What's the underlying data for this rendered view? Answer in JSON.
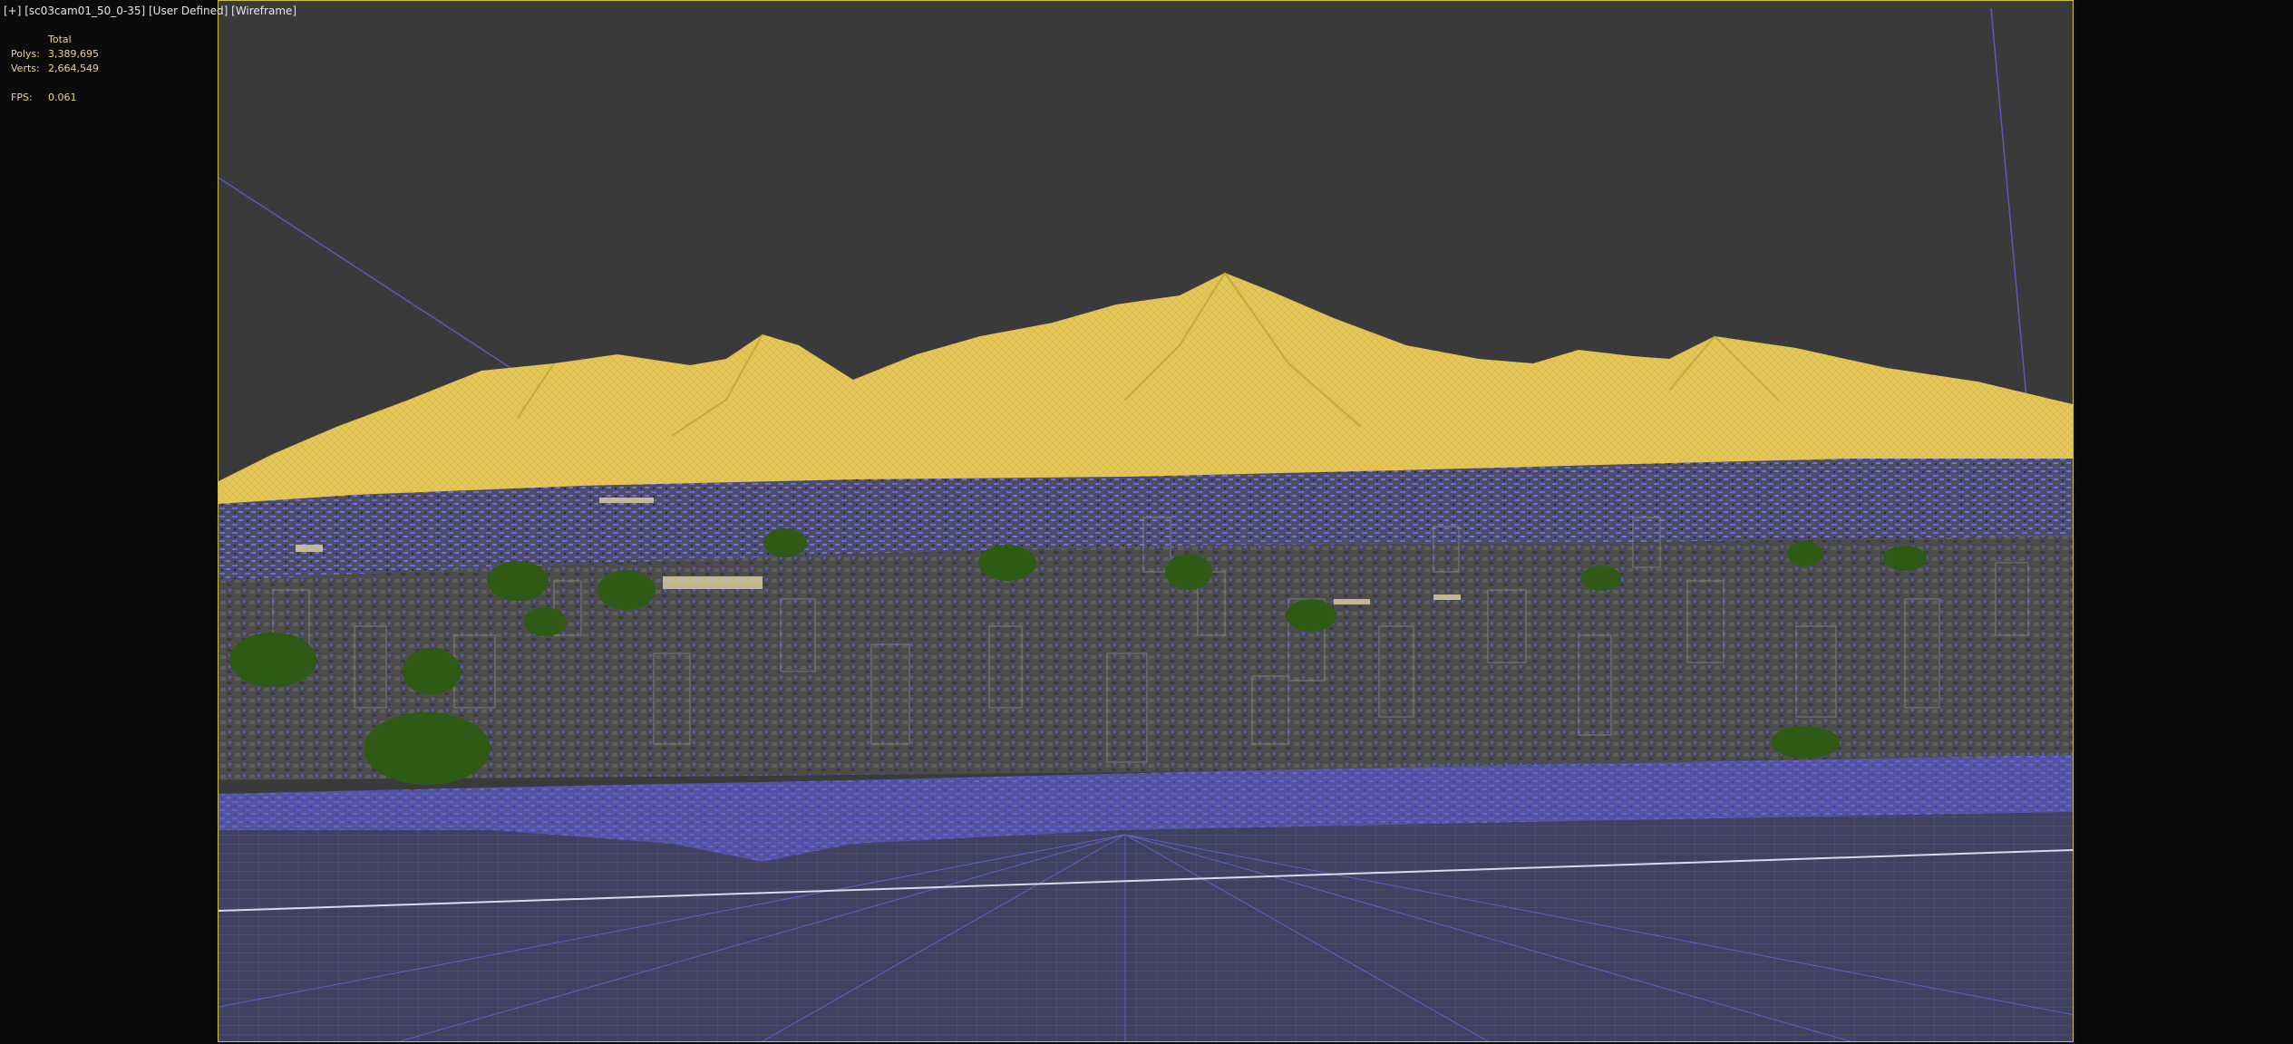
{
  "viewport": {
    "label_parts": [
      "[+]",
      "[sc03cam01_50_0-35]",
      "[User Defined]",
      "[Wireframe]"
    ]
  },
  "stats": {
    "header": "Total",
    "polys_label": "Polys:",
    "polys_value": "3,389,695",
    "verts_label": "Verts:",
    "verts_value": "2,664,549",
    "fps_label": "FPS:",
    "fps_value": "0.061"
  },
  "colors": {
    "background": "#3a3a3a",
    "mountain": "#e3c558",
    "wire_blue": "#6a6ae0",
    "foliage_green": "#2f5a16",
    "frame_border": "#c8c14a",
    "stat_text": "#e8d59b"
  },
  "icons": {
    "viewport_scene": "wireframe-landscape-render"
  }
}
